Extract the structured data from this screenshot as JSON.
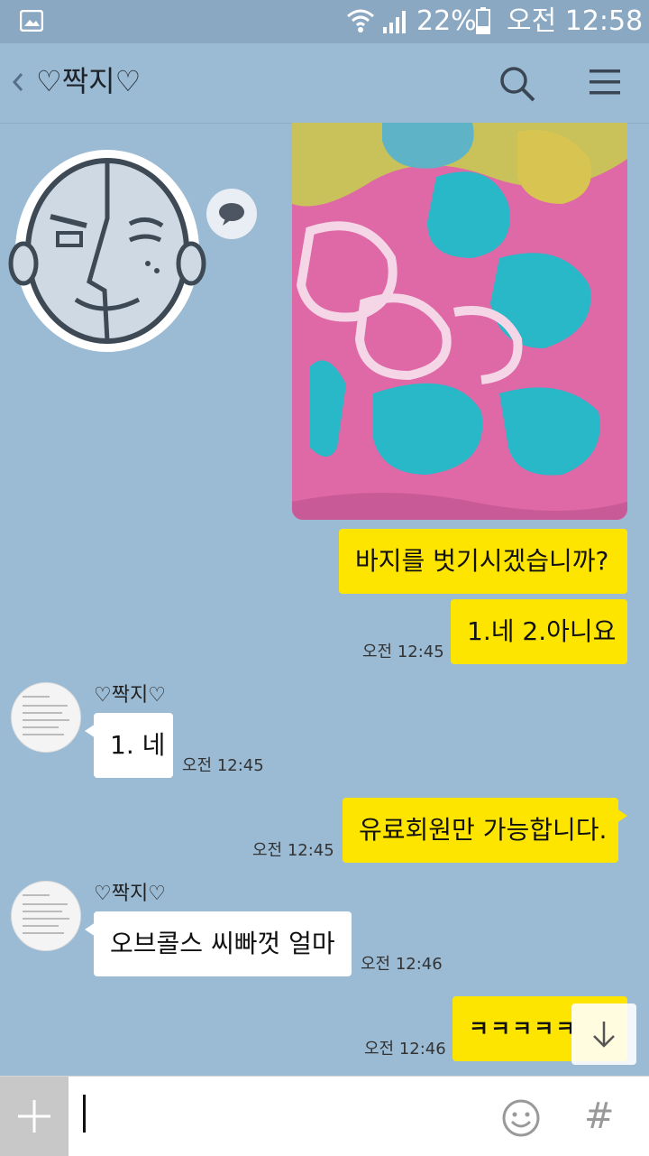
{
  "status_bar": {
    "battery_percent": "22%",
    "time": "오전 12:58"
  },
  "header": {
    "title": "♡짝지♡"
  },
  "messages": [
    {
      "sender": "me",
      "text": "바지를 벗기시겠습니까?"
    },
    {
      "sender": "me",
      "text": "1.네 2.아니요",
      "time": "오전 12:45"
    },
    {
      "sender": "other",
      "name": "♡짝지♡",
      "text": "1. 네",
      "time": "오전 12:45"
    },
    {
      "sender": "me",
      "text": "유료회원만 가능합니다.",
      "time": "오전 12:45"
    },
    {
      "sender": "other",
      "name": "♡짝지♡",
      "text": "오브콜스 씨빠껏 얼마",
      "time": "오전 12:46"
    },
    {
      "sender": "me",
      "text": "ㅋㅋㅋㅋㅋ",
      "time": "오전 12:46"
    }
  ],
  "input": {
    "value": "",
    "hash_label": "#"
  },
  "colors": {
    "chat_background": "#9bbbd4",
    "my_bubble": "#fee500",
    "other_bubble": "#ffffff"
  },
  "icons": [
    "gallery-icon",
    "wifi-icon",
    "signal-icon",
    "battery-icon",
    "back-icon",
    "search-icon",
    "menu-icon",
    "speech-bubble-icon",
    "arrow-down-icon",
    "plus-icon",
    "emoji-icon",
    "hash-icon"
  ]
}
